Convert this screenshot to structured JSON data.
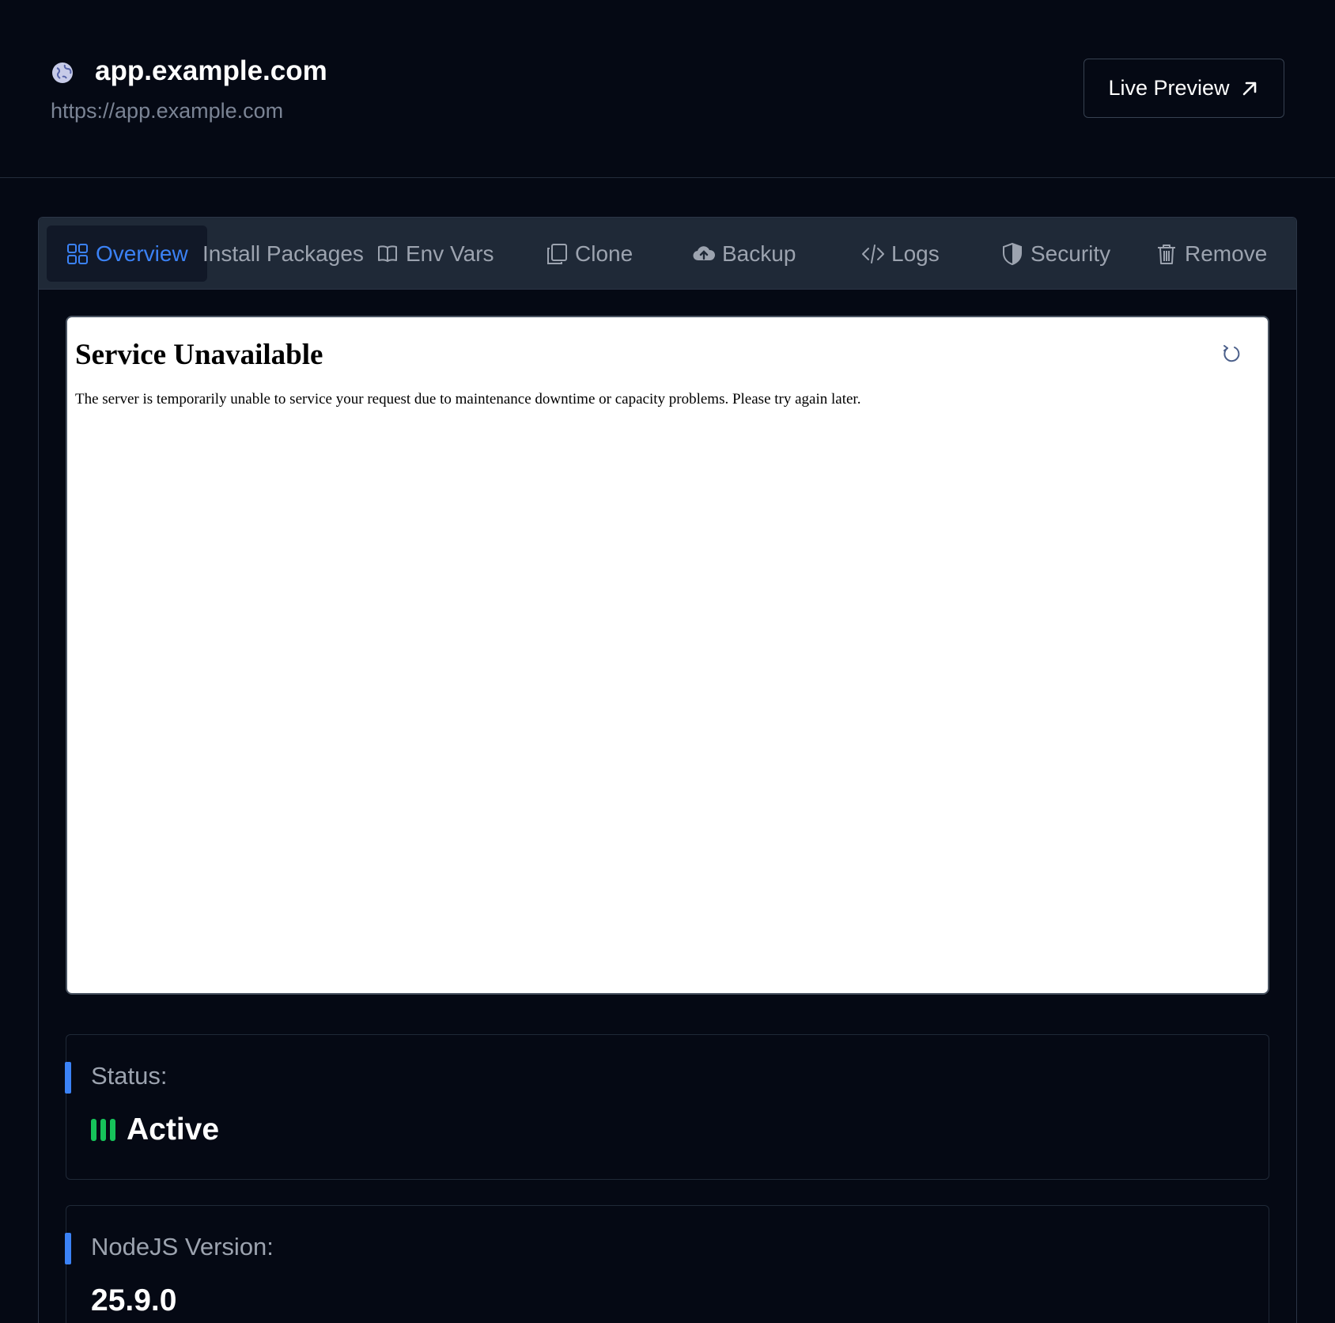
{
  "header": {
    "site_title": "app.example.com",
    "site_url": "https://app.example.com",
    "live_preview_label": "Live Preview"
  },
  "tabs": [
    {
      "label": "Overview",
      "icon": "grid-icon",
      "active": true
    },
    {
      "label": "Install Packages",
      "icon": "",
      "active": false
    },
    {
      "label": "Env Vars",
      "icon": "book-icon",
      "active": false
    },
    {
      "label": "Clone",
      "icon": "copy-icon",
      "active": false
    },
    {
      "label": "Backup",
      "icon": "cloud-upload-icon",
      "active": false
    },
    {
      "label": "Logs",
      "icon": "code-icon",
      "active": false
    },
    {
      "label": "Security",
      "icon": "shield-icon",
      "active": false
    },
    {
      "label": "Remove",
      "icon": "trash-icon",
      "active": false
    }
  ],
  "preview": {
    "title": "Service Unavailable",
    "message": "The server is temporarily unable to service your request due to maintenance downtime or capacity problems. Please try again later."
  },
  "status_card": {
    "label": "Status:",
    "value": "Active",
    "color": "#16c35a"
  },
  "node_card": {
    "label": "NodeJS Version:",
    "value": "25.9.0"
  },
  "colors": {
    "background": "#050914",
    "accent": "#3b82f6",
    "tabbar": "#1f2937"
  }
}
